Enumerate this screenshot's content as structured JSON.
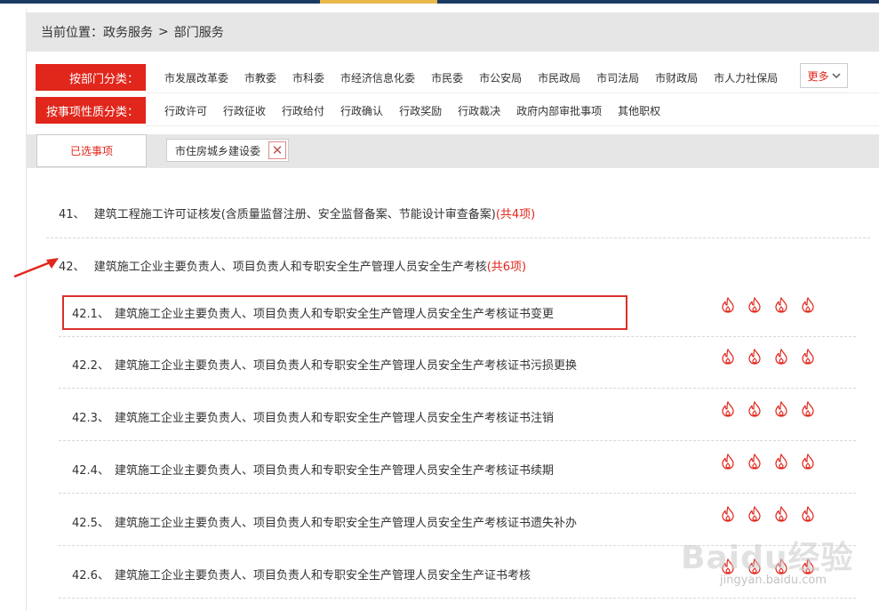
{
  "breadcrumb": {
    "prefix": "当前位置：",
    "parts": [
      "政务服务",
      ">",
      "部门服务"
    ]
  },
  "dept_filter": {
    "label": "按部门分类：",
    "options": [
      "市发展改革委",
      "市教委",
      "市科委",
      "市经济信息化委",
      "市民委",
      "市公安局",
      "市民政局",
      "市司法局",
      "市财政局",
      "市人力社保局"
    ],
    "more_label": "更多"
  },
  "type_filter": {
    "label": "按事项性质分类：",
    "options": [
      "行政许可",
      "行政征收",
      "行政给付",
      "行政确认",
      "行政奖励",
      "行政裁决",
      "政府内部审批事项",
      "其他职权"
    ]
  },
  "selected": {
    "title": "已选事项",
    "chips": [
      "市住房城乡建设委"
    ],
    "remove_glyph": "✕"
  },
  "items": [
    {
      "num": "41、",
      "title": "建筑工程施工许可证核发(含质量监督注册、安全监督备案、节能设计审查备案)",
      "count": "(共4项)"
    },
    {
      "num": "42、",
      "title": "建筑施工企业主要负责人、项目负责人和专职安全生产管理人员安全生产考核",
      "count": "(共6项)"
    }
  ],
  "subitems": [
    {
      "num": "42.1、",
      "title": "建筑施工企业主要负责人、项目负责人和专职安全生产管理人员安全生产考核证书变更"
    },
    {
      "num": "42.2、",
      "title": "建筑施工企业主要负责人、项目负责人和专职安全生产管理人员安全生产考核证书污损更换"
    },
    {
      "num": "42.3、",
      "title": "建筑施工企业主要负责人、项目负责人和专职安全生产管理人员安全生产考核证书注销"
    },
    {
      "num": "42.4、",
      "title": "建筑施工企业主要负责人、项目负责人和专职安全生产管理人员安全生产考核证书续期"
    },
    {
      "num": "42.5、",
      "title": "建筑施工企业主要负责人、项目负责人和专职安全生产管理人员安全生产考核证书遗失补办"
    },
    {
      "num": "42.6、",
      "title": "建筑施工企业主要负责人、项目负责人和专职安全生产管理人员安全生产证书考核"
    }
  ],
  "watermark": {
    "brand": "Baidu经验",
    "url": "jingyan.baidu.com"
  },
  "colors": {
    "accent": "#e1261c",
    "nav": "#1b3a63",
    "gold": "#e8b84a",
    "panel": "#e6e6e6"
  }
}
